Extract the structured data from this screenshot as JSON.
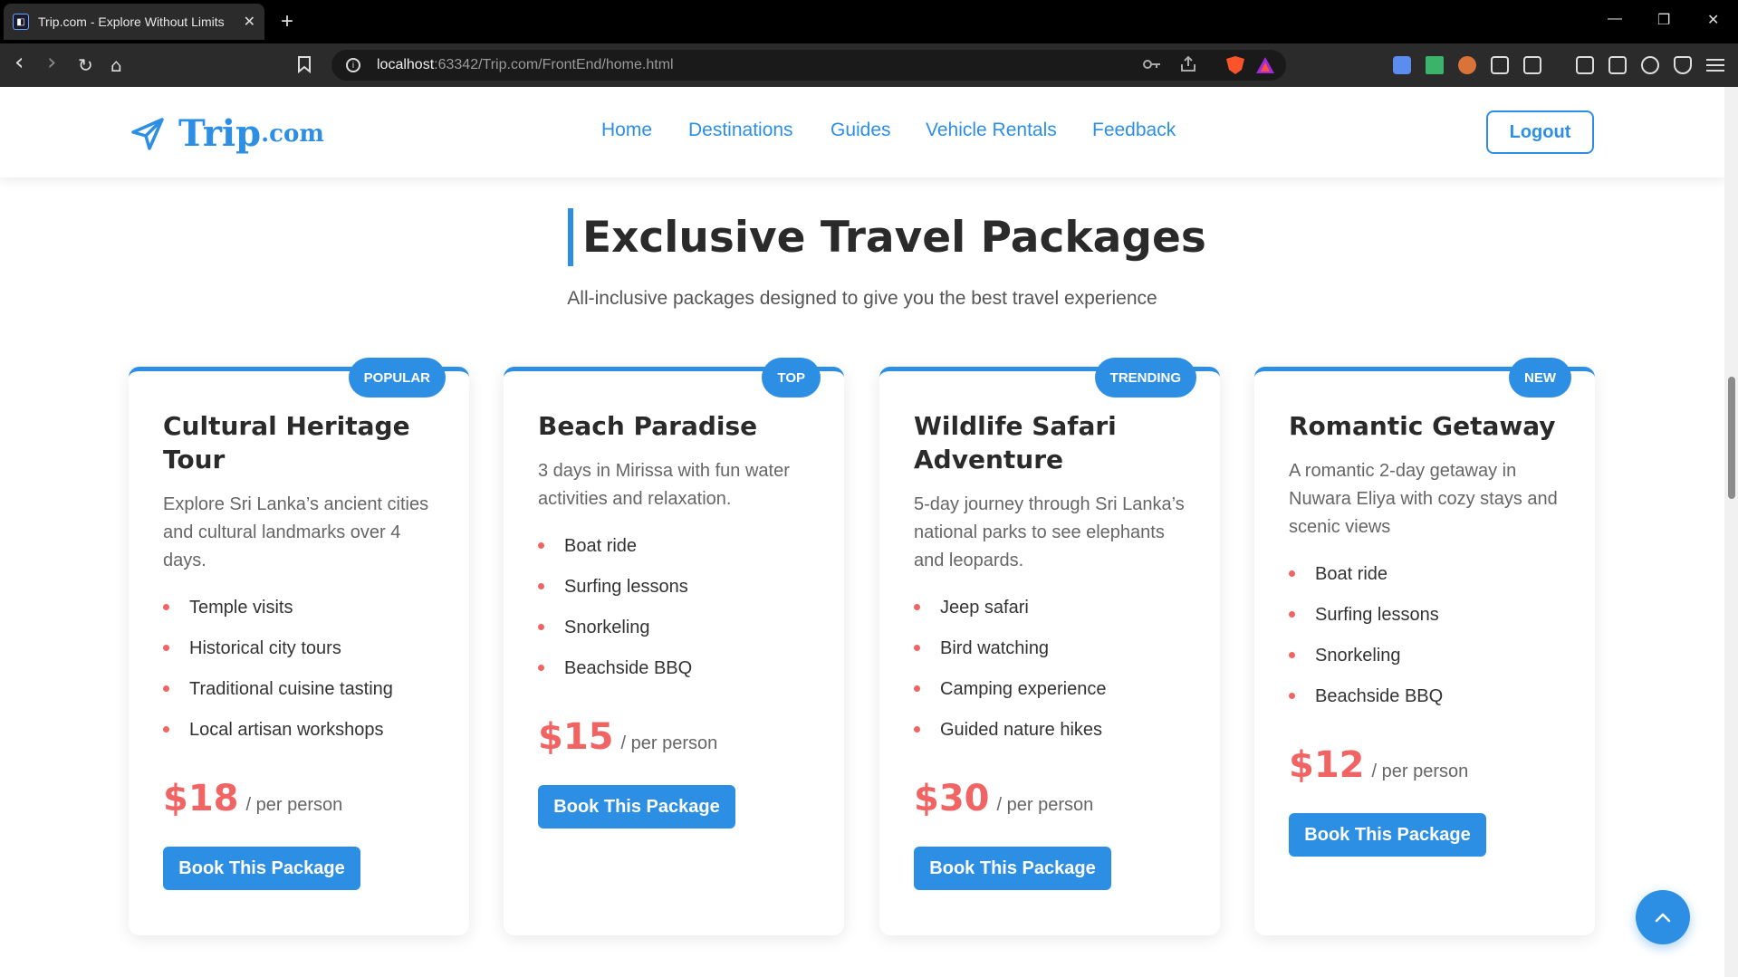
{
  "browser": {
    "tab_title": "Trip.com - Explore Without Limits",
    "tab_close": "✕",
    "new_tab": "+",
    "url_host": "localhost",
    "url_rest": ":63342/Trip.com/FrontEnd/home.html",
    "win_min": "—",
    "win_restore": "❐",
    "win_close": "✕",
    "back": "‹",
    "forward": "›",
    "reload": "↻",
    "home": "⌂"
  },
  "header": {
    "logo_name": "Trip",
    "logo_suffix": ".com",
    "nav": [
      "Home",
      "Destinations",
      "Guides",
      "Vehicle Rentals",
      "Feedback"
    ],
    "logout_label": "Logout"
  },
  "section": {
    "title": "Exclusive Travel Packages",
    "subtitle": "All-inclusive packages designed to give you the best travel experience"
  },
  "packages": [
    {
      "badge": "POPULAR",
      "title": "Cultural Heritage Tour",
      "description": "Explore Sri Lanka’s ancient cities and cultural landmarks over 4 days.",
      "features": [
        "Temple visits",
        "Historical city tours",
        "Traditional cuisine tasting",
        "Local artisan workshops"
      ],
      "price": "$18",
      "per": "/ per person",
      "button": "Book This Package"
    },
    {
      "badge": "TOP",
      "title": "Beach Paradise",
      "description": "3 days in Mirissa with fun water activities and relaxation.",
      "features": [
        "Boat ride",
        "Surfing lessons",
        "Snorkeling",
        "Beachside BBQ"
      ],
      "price": "$15",
      "per": "/ per person",
      "button": "Book This Package"
    },
    {
      "badge": "TRENDING",
      "title": "Wildlife Safari Adventure",
      "description": "5-day journey through Sri Lanka’s national parks to see elephants and leopards.",
      "features": [
        "Jeep safari",
        "Bird watching",
        "Camping experience",
        "Guided nature hikes"
      ],
      "price": "$30",
      "per": "/ per person",
      "button": "Book This Package"
    },
    {
      "badge": "NEW",
      "title": "Romantic Getaway",
      "description": "A romantic 2-day getaway in Nuwara Eliya with cozy stays and scenic views",
      "features": [
        "Boat ride",
        "Surfing lessons",
        "Snorkeling",
        "Beachside BBQ"
      ],
      "price": "$12",
      "per": "/ per person",
      "button": "Book This Package"
    }
  ],
  "colors": {
    "brand": "#2d8fe4",
    "price": "#f06464",
    "bullet": "#f06464"
  }
}
